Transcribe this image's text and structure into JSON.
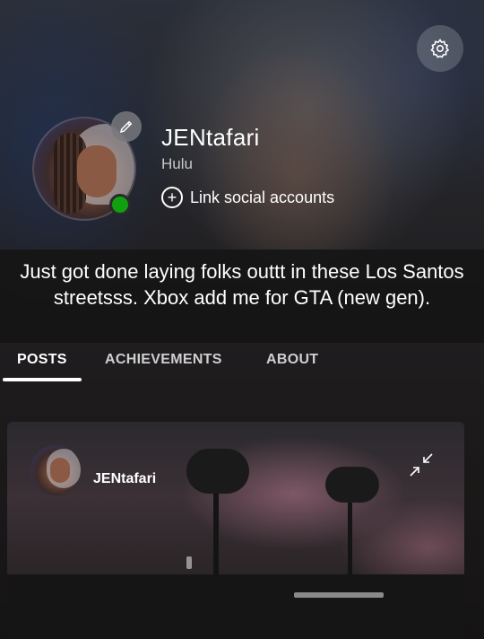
{
  "profile": {
    "gamertag": "JENtafari",
    "subtitle": "Hulu",
    "link_social_label": "Link social accounts",
    "status": "online",
    "bio": "Just got done laying folks outtt in these Los Santos streetsss. Xbox add me for GTA (new gen)."
  },
  "icons": {
    "settings": "gear-icon",
    "edit": "pencil-icon",
    "link": "plus-circle-icon",
    "collapse": "collapse-arrows-icon"
  },
  "tabs": [
    {
      "label": "POSTS",
      "active": true
    },
    {
      "label": "ACHIEVEMENTS",
      "active": false
    },
    {
      "label": "ABOUT",
      "active": false
    }
  ],
  "posts": [
    {
      "author": "JENtafari"
    }
  ],
  "colors": {
    "online": "#10a010",
    "accent": "#ffffff"
  }
}
